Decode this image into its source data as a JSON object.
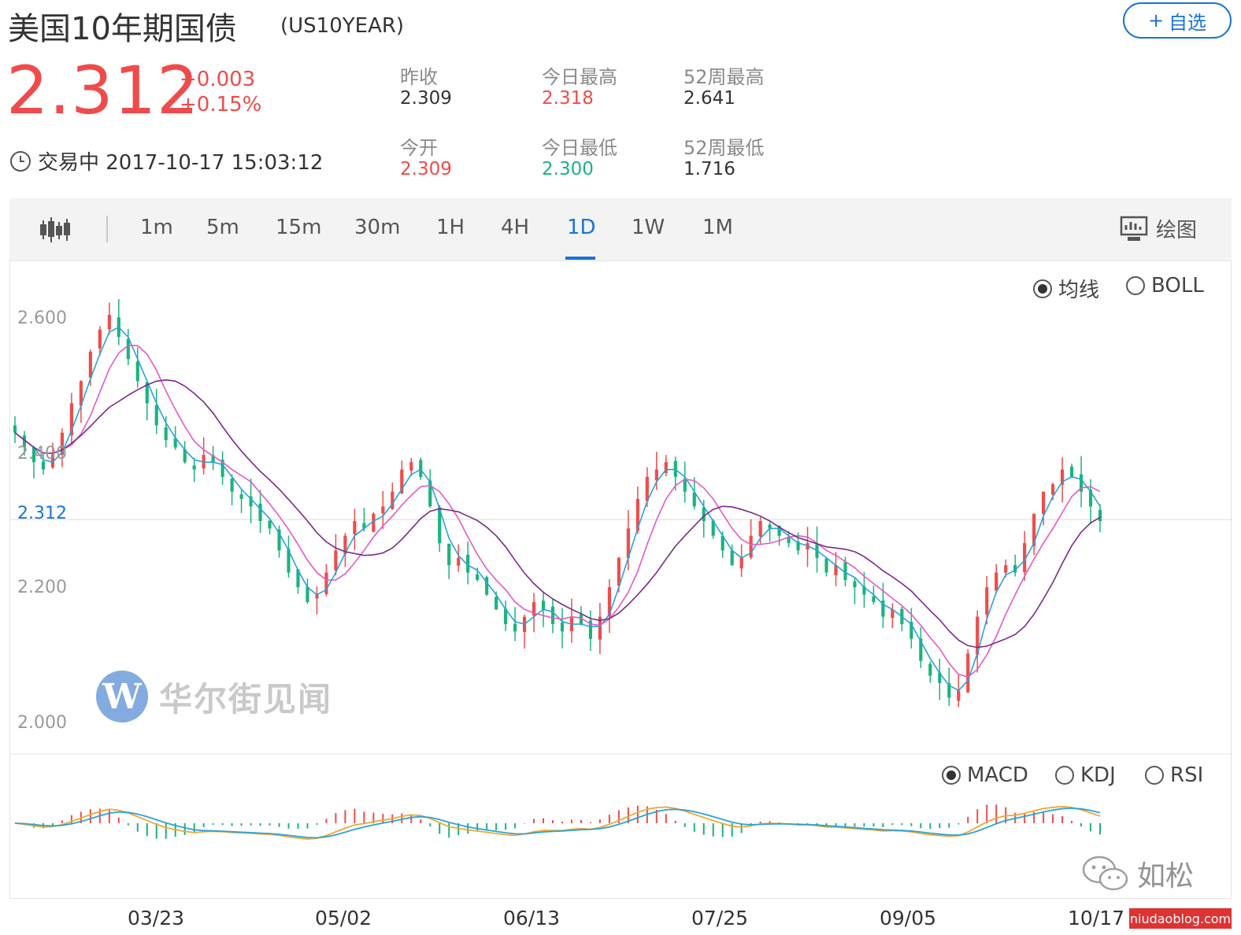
{
  "header": {
    "title": "美国10年期国债",
    "symbol": "(US10YEAR)",
    "watch_plus": "+",
    "watch_label": "自选"
  },
  "quote": {
    "price": "2.312",
    "change": "+0.003",
    "change_pct": "+0.15%",
    "status": "交易中 2017-10-17 15:03:12"
  },
  "stats": [
    {
      "label": "昨收",
      "value": "2.309",
      "color": "dark"
    },
    {
      "label": "今日最高",
      "value": "2.318",
      "color": "red"
    },
    {
      "label": "52周最高",
      "value": "2.641",
      "color": "dark"
    },
    {
      "label": "今开",
      "value": "2.309",
      "color": "red"
    },
    {
      "label": "今日最低",
      "value": "2.300",
      "color": "green"
    },
    {
      "label": "52周最低",
      "value": "1.716",
      "color": "dark"
    }
  ],
  "toolbar": {
    "periods": [
      "1m",
      "5m",
      "15m",
      "30m",
      "1H",
      "4H",
      "1D",
      "1W",
      "1M"
    ],
    "active": "1D",
    "draw_label": "绘图"
  },
  "main_chart": {
    "overlay_options": [
      "均线",
      "BOLL"
    ],
    "overlay_selected": "均线",
    "y_ticks": [
      "2.600",
      "2.400",
      "2.200",
      "2.000"
    ],
    "current_label": "2.312",
    "x_labels": [
      "03/23",
      "05/02",
      "06/13",
      "07/25",
      "09/05",
      "10/17"
    ]
  },
  "sub_chart": {
    "indicator_options": [
      "MACD",
      "KDJ",
      "RSI"
    ],
    "indicator_selected": "MACD"
  },
  "watermark": {
    "logo_letter": "W",
    "logo_text": "华尔街见闻",
    "wechat_name": "如松",
    "site": "niudaoblog.com"
  },
  "colors": {
    "up": "#ef4b4b",
    "down": "#1bb37d",
    "accent": "#1a73d9",
    "ma5": "#29a3d8",
    "ma10": "#e35ac6",
    "ma20": "#7a2a8a",
    "macd_dif": "#f0a830",
    "macd_dea": "#29a3d8"
  },
  "chart_data": {
    "type": "candlestick",
    "x": [
      "03/23",
      "05/02",
      "06/13",
      "07/25",
      "09/05",
      "10/17"
    ],
    "ylim": [
      2.0,
      2.65
    ],
    "closes_approx": [
      2.43,
      2.41,
      2.39,
      2.38,
      2.4,
      2.43,
      2.47,
      2.5,
      2.54,
      2.57,
      2.59,
      2.56,
      2.53,
      2.5,
      2.47,
      2.44,
      2.42,
      2.41,
      2.39,
      2.38,
      2.4,
      2.39,
      2.37,
      2.35,
      2.34,
      2.33,
      2.31,
      2.3,
      2.27,
      2.24,
      2.22,
      2.2,
      2.21,
      2.24,
      2.27,
      2.29,
      2.31,
      2.3,
      2.32,
      2.33,
      2.35,
      2.38,
      2.39,
      2.37,
      2.33,
      2.28,
      2.25,
      2.26,
      2.24,
      2.23,
      2.21,
      2.19,
      2.17,
      2.16,
      2.18,
      2.2,
      2.19,
      2.17,
      2.16,
      2.18,
      2.17,
      2.15,
      2.18,
      2.22,
      2.26,
      2.3,
      2.34,
      2.37,
      2.38,
      2.39,
      2.37,
      2.35,
      2.33,
      2.31,
      2.29,
      2.27,
      2.25,
      2.26,
      2.29,
      2.31,
      2.3,
      2.29,
      2.28,
      2.27,
      2.28,
      2.26,
      2.24,
      2.25,
      2.23,
      2.22,
      2.21,
      2.2,
      2.18,
      2.19,
      2.17,
      2.15,
      2.12,
      2.1,
      2.09,
      2.07,
      2.08,
      2.13,
      2.18,
      2.22,
      2.24,
      2.25,
      2.24,
      2.28,
      2.32,
      2.35,
      2.36,
      2.38,
      2.37,
      2.35,
      2.33,
      2.31
    ]
  }
}
